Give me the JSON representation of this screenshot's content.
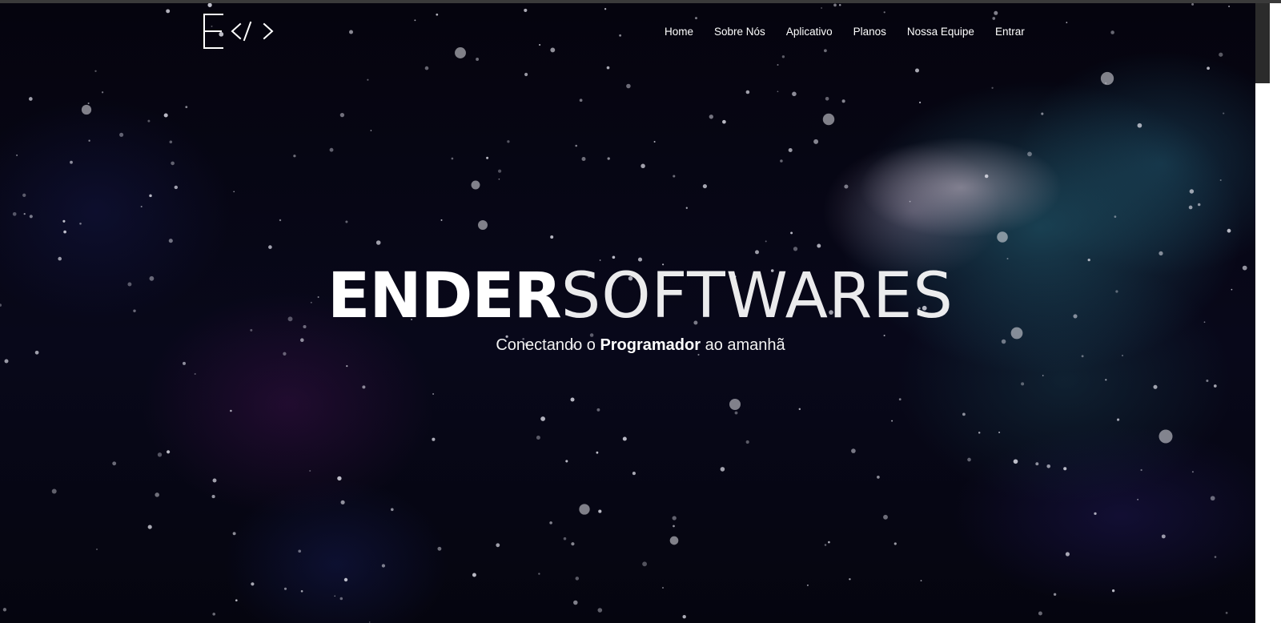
{
  "brand": {
    "logo_letter": "E",
    "logo_code": "</>"
  },
  "nav": {
    "items": [
      {
        "label": "Home"
      },
      {
        "label": "Sobre Nós"
      },
      {
        "label": "Aplicativo"
      },
      {
        "label": "Planos"
      },
      {
        "label": "Nossa Equipe"
      },
      {
        "label": "Entrar"
      }
    ]
  },
  "hero": {
    "title_bold": "ENDER",
    "title_light": "SOFTWARES",
    "tagline_pre": "Conectando o ",
    "tagline_bold": "Programador",
    "tagline_post": " ao amanhã"
  },
  "colors": {
    "background": "#07071a",
    "text": "#ffffff",
    "nebula_teal": "#2a6e82",
    "nebula_purple": "#501a5a"
  }
}
